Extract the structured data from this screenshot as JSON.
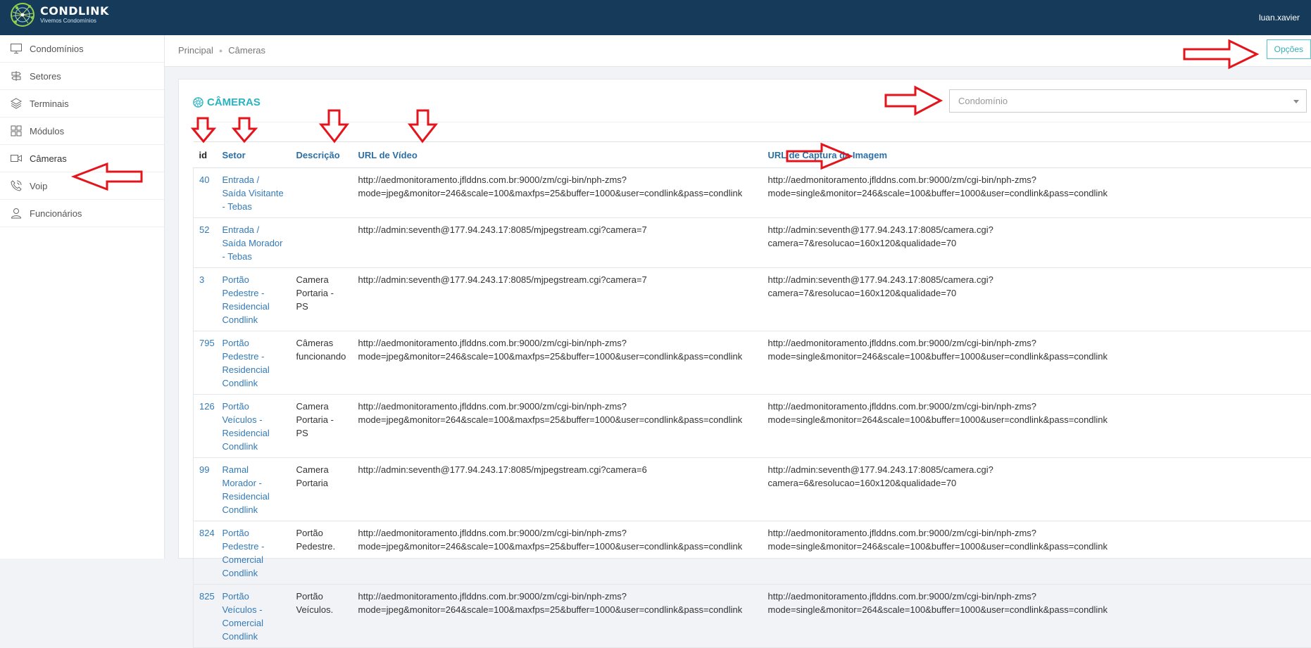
{
  "header": {
    "brand": "CONDLINK",
    "tagline": "Vivemos Condomínios",
    "user": "luan.xavier"
  },
  "sidebar": {
    "items": [
      {
        "label": "Condomínios",
        "icon": "monitor-icon"
      },
      {
        "label": "Setores",
        "icon": "signpost-icon"
      },
      {
        "label": "Terminais",
        "icon": "layers-icon"
      },
      {
        "label": "Módulos",
        "icon": "grid-icon"
      },
      {
        "label": "Câmeras",
        "icon": "video-camera-icon"
      },
      {
        "label": "Voip",
        "icon": "phone-icon"
      },
      {
        "label": "Funcionários",
        "icon": "user-icon"
      }
    ]
  },
  "breadcrumb": {
    "home": "Principal",
    "current": "Câmeras"
  },
  "options_label": "Opções",
  "card": {
    "title": "CÂMERAS",
    "select_placeholder": "Condomínio"
  },
  "table": {
    "columns": [
      "id",
      "Setor",
      "Descrição",
      "URL de Vídeo",
      "URL de Captura da Imagem"
    ],
    "rows": [
      {
        "id": "40",
        "setor": "Entrada / Saída Visitante - Tebas",
        "descricao": "",
        "video": "http://aedmonitoramento.jflddns.com.br:9000/zm/cgi-bin/nph-zms?\nmode=jpeg&monitor=246&scale=100&maxfps=25&buffer=1000&user=condlink&pass=condlink",
        "captura": "http://aedmonitoramento.jflddns.com.br:9000/zm/cgi-bin/nph-zms?\nmode=single&monitor=246&scale=100&buffer=1000&user=condlink&pass=condlink"
      },
      {
        "id": "52",
        "setor": "Entrada / Saída Morador - Tebas",
        "descricao": "",
        "video": "http://admin:seventh@177.94.243.17:8085/mjpegstream.cgi?camera=7",
        "captura": "http://admin:seventh@177.94.243.17:8085/camera.cgi?\ncamera=7&resolucao=160x120&qualidade=70"
      },
      {
        "id": "3",
        "setor": "Portão Pedestre - Residencial Condlink",
        "descricao": "Camera Portaria - PS",
        "video": "http://admin:seventh@177.94.243.17:8085/mjpegstream.cgi?camera=7",
        "captura": "http://admin:seventh@177.94.243.17:8085/camera.cgi?\ncamera=7&resolucao=160x120&qualidade=70"
      },
      {
        "id": "795",
        "setor": "Portão Pedestre - Residencial Condlink",
        "descricao": "Câmeras funcionando",
        "video": "http://aedmonitoramento.jflddns.com.br:9000/zm/cgi-bin/nph-zms?\nmode=jpeg&monitor=246&scale=100&maxfps=25&buffer=1000&user=condlink&pass=condlink",
        "captura": "http://aedmonitoramento.jflddns.com.br:9000/zm/cgi-bin/nph-zms?\nmode=single&monitor=246&scale=100&buffer=1000&user=condlink&pass=condlink"
      },
      {
        "id": "126",
        "setor": "Portão Veículos - Residencial Condlink",
        "descricao": "Camera Portaria - PS",
        "video": "http://aedmonitoramento.jflddns.com.br:9000/zm/cgi-bin/nph-zms?\nmode=jpeg&monitor=264&scale=100&maxfps=25&buffer=1000&user=condlink&pass=condlink",
        "captura": "http://aedmonitoramento.jflddns.com.br:9000/zm/cgi-bin/nph-zms?\nmode=single&monitor=264&scale=100&buffer=1000&user=condlink&pass=condlink"
      },
      {
        "id": "99",
        "setor": "Ramal Morador - Residencial Condlink",
        "descricao": "Camera Portaria",
        "video": "http://admin:seventh@177.94.243.17:8085/mjpegstream.cgi?camera=6",
        "captura": "http://admin:seventh@177.94.243.17:8085/camera.cgi?\ncamera=6&resolucao=160x120&qualidade=70"
      },
      {
        "id": "824",
        "setor": "Portão Pedestre - Comercial Condlink",
        "descricao": "Portão Pedestre.",
        "video": "http://aedmonitoramento.jflddns.com.br:9000/zm/cgi-bin/nph-zms?\nmode=jpeg&monitor=246&scale=100&maxfps=25&buffer=1000&user=condlink&pass=condlink",
        "captura": "http://aedmonitoramento.jflddns.com.br:9000/zm/cgi-bin/nph-zms?\nmode=single&monitor=246&scale=100&buffer=1000&user=condlink&pass=condlink"
      },
      {
        "id": "825",
        "setor": "Portão Veículos - Comercial Condlink",
        "descricao": "Portão Veículos.",
        "video": "http://aedmonitoramento.jflddns.com.br:9000/zm/cgi-bin/nph-zms?\nmode=jpeg&monitor=264&scale=100&maxfps=25&buffer=1000&user=condlink&pass=condlink",
        "captura": "http://aedmonitoramento.jflddns.com.br:9000/zm/cgi-bin/nph-zms?\nmode=single&monitor=264&scale=100&buffer=1000&user=condlink&pass=condlink"
      }
    ]
  },
  "colors": {
    "topbar": "#153a5a",
    "accent": "#2ab3c2",
    "link": "#337ab7",
    "annotation_arrow": "#e3141b"
  }
}
